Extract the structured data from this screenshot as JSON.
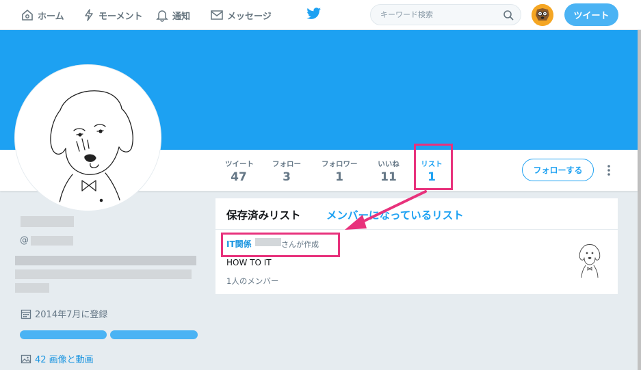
{
  "nav": {
    "home_label": "ホーム",
    "moments_label": "モーメント",
    "notifications_label": "通知",
    "messages_label": "メッセージ",
    "search_placeholder": "キーワード検索",
    "tweet_button": "ツイート"
  },
  "profile": {
    "handle_prefix": "@",
    "joined": "2014年7月に登録",
    "media_link": "42 画像と動画"
  },
  "stats": [
    {
      "label": "ツイート",
      "value": "47"
    },
    {
      "label": "フォロー",
      "value": "3"
    },
    {
      "label": "フォロワー",
      "value": "1"
    },
    {
      "label": "いいね",
      "value": "11"
    },
    {
      "label": "リスト",
      "value": "1"
    }
  ],
  "follow_button": "フォローする",
  "lists": {
    "tab_saved": "保存済みリスト",
    "tab_member": "メンバーになっているリスト",
    "items": [
      {
        "name": "IT関係",
        "owner_suffix": "さんが作成",
        "description": "HOW TO IT",
        "members": "1人のメンバー"
      }
    ]
  },
  "colors": {
    "brand_blue": "#1da1f2",
    "highlight_pink": "#e8327c"
  }
}
